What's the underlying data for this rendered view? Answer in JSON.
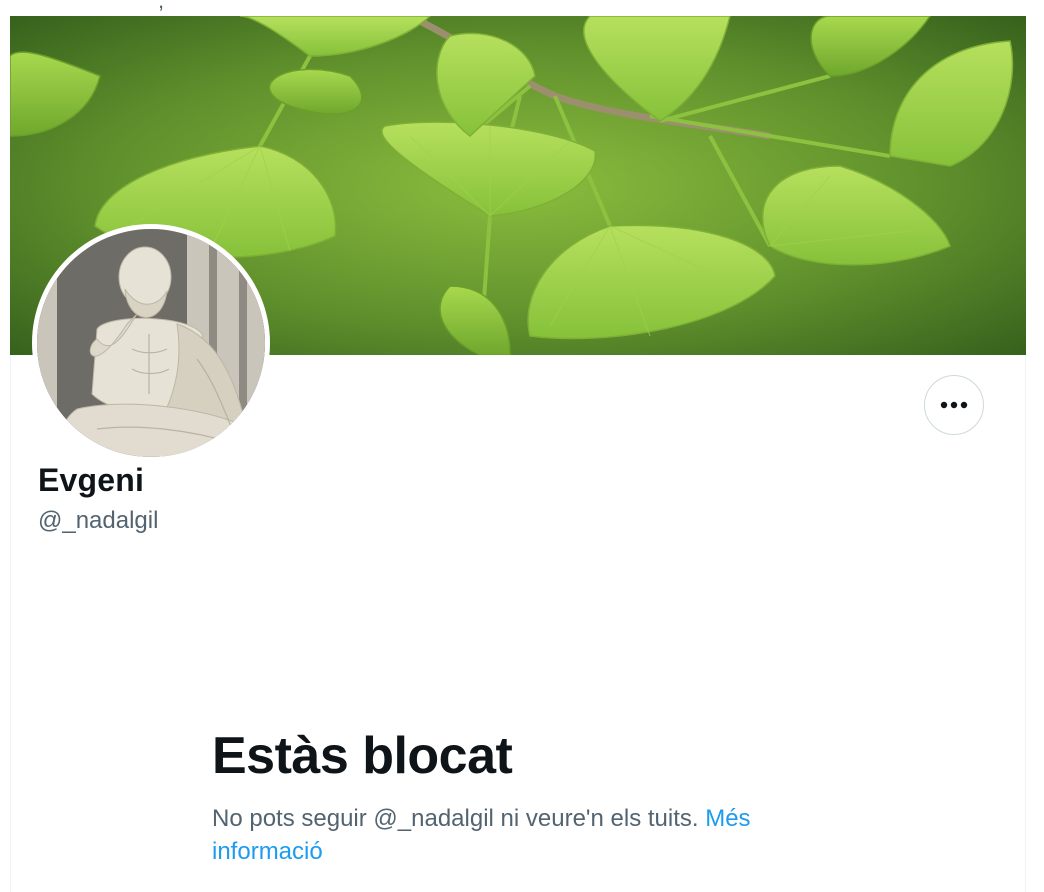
{
  "profile": {
    "display_name": "Evgeni",
    "handle": "@_nadalgil"
  },
  "header": {
    "more_button_icon": "more-horizontal-icon"
  },
  "blocked": {
    "title": "Estàs blocat",
    "description": "No pots seguir @_nadalgil ni veure'n els tuits.",
    "link_label": "Més informació"
  },
  "colors": {
    "text_primary": "#0f1419",
    "text_secondary": "#536471",
    "link": "#1d9bf0",
    "border": "#cfd9de"
  }
}
